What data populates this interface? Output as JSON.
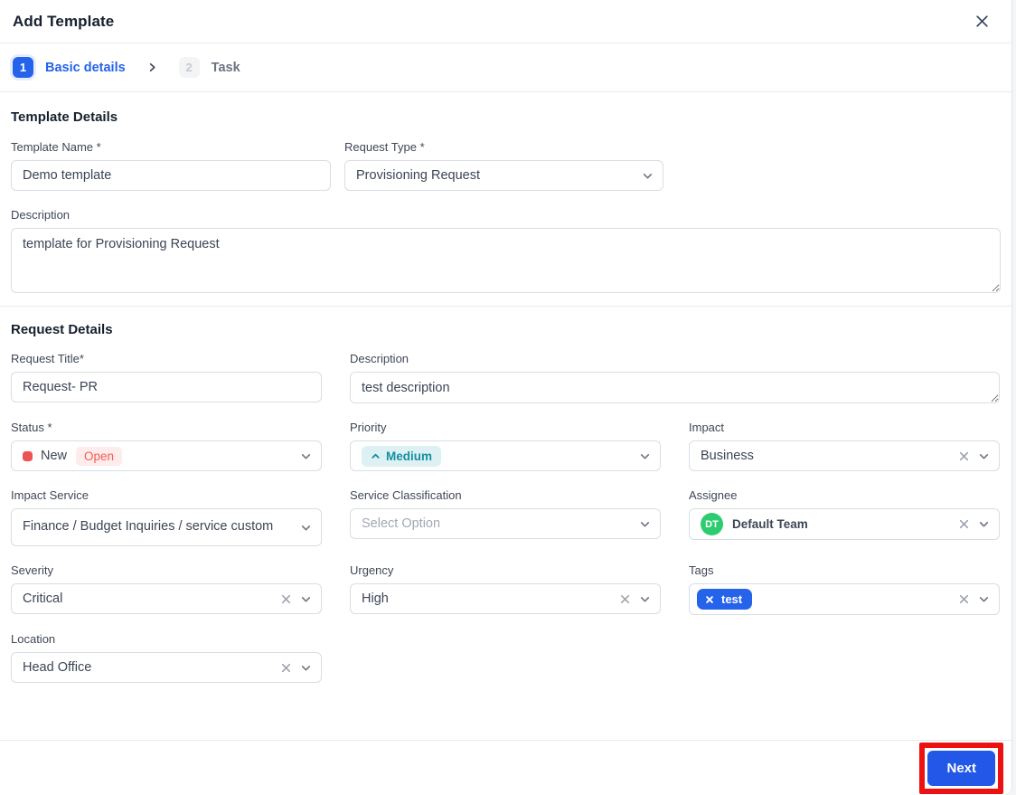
{
  "dialog": {
    "title": "Add Template"
  },
  "stepper": {
    "steps": [
      {
        "number": "1",
        "label": "Basic details"
      },
      {
        "number": "2",
        "label": "Task"
      }
    ]
  },
  "template_details": {
    "heading": "Template Details",
    "template_name": {
      "label": "Template Name *",
      "value": "Demo template"
    },
    "request_type": {
      "label": "Request Type *",
      "value": "Provisioning Request"
    },
    "description": {
      "label": "Description",
      "value": "template for Provisioning Request"
    }
  },
  "request_details": {
    "heading": "Request Details",
    "request_title": {
      "label": "Request Title*",
      "value": "Request- PR"
    },
    "description": {
      "label": "Description",
      "value": "test description"
    },
    "status": {
      "label": "Status *",
      "value": "New",
      "badge": "Open"
    },
    "priority": {
      "label": "Priority",
      "value": "Medium"
    },
    "impact": {
      "label": "Impact",
      "value": "Business"
    },
    "impact_service": {
      "label": "Impact Service",
      "value": "Finance / Budget Inquiries / service custom"
    },
    "service_classification": {
      "label": "Service Classification",
      "placeholder": "Select Option"
    },
    "assignee": {
      "label": "Assignee",
      "value": "Default Team",
      "avatar_initials": "DT"
    },
    "severity": {
      "label": "Severity",
      "value": "Critical"
    },
    "urgency": {
      "label": "Urgency",
      "value": "High"
    },
    "tags": {
      "label": "Tags",
      "chips": [
        "test"
      ]
    },
    "location": {
      "label": "Location",
      "value": "Head Office"
    }
  },
  "footer": {
    "next_label": "Next"
  },
  "colors": {
    "accent_blue": "#2563eb",
    "status_red": "#ee5253",
    "status_open_bg": "#fdeceb",
    "priority_teal": "#178fa0",
    "priority_teal_bg": "#ddf1f4",
    "avatar_green": "#2ecc71",
    "tag_blue": "#2563eb",
    "next_button_blue": "#2257e7",
    "annotation_red": "#ee1111"
  }
}
